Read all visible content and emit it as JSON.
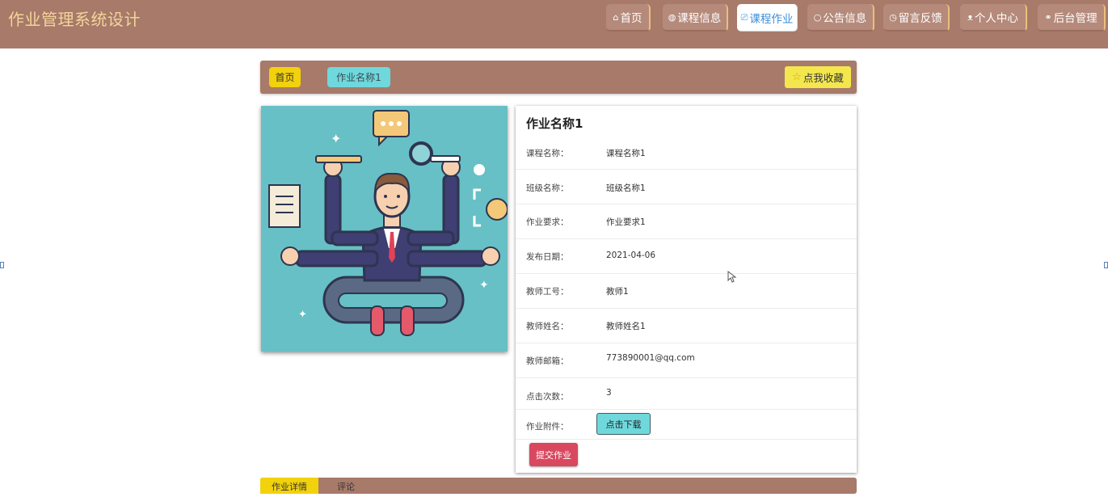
{
  "site": {
    "title": "作业管理系统设计"
  },
  "nav": [
    {
      "icon": "home-icon",
      "glyph": "⌂",
      "label": "首页"
    },
    {
      "icon": "globe-icon",
      "glyph": "◍",
      "label": "课程信息"
    },
    {
      "icon": "book-icon",
      "glyph": "⎚",
      "label": "课程作业"
    },
    {
      "icon": "chat-icon",
      "glyph": "○",
      "label": "公告信息"
    },
    {
      "icon": "clock-icon",
      "glyph": "◷",
      "label": "留言反馈"
    },
    {
      "icon": "user-icon",
      "glyph": "ᴥ",
      "label": "个人中心"
    },
    {
      "icon": "link-icon",
      "glyph": "⚭",
      "label": "后台管理"
    }
  ],
  "active_nav": "课程作业",
  "breadcrumb": {
    "home": "首页",
    "current": "作业名称1"
  },
  "favorite_label": "点我收藏",
  "detail": {
    "title": "作业名称1",
    "fields": [
      {
        "label": "课程名称：",
        "value": "课程名称1"
      },
      {
        "label": "班级名称：",
        "value": "班级名称1"
      },
      {
        "label": "作业要求：",
        "value": "作业要求1"
      },
      {
        "label": "发布日期：",
        "value": "2021-04-06"
      },
      {
        "label": "教师工号：",
        "value": "教师1"
      },
      {
        "label": "教师姓名：",
        "value": "教师姓名1"
      },
      {
        "label": "教师邮箱：",
        "value": "773890001@qq.com"
      },
      {
        "label": "点击次数：",
        "value": "3"
      }
    ],
    "attachment_label": "作业附件：",
    "download_label": "点击下载",
    "submit_label": "提交作业"
  },
  "bottom_tabs": [
    "作业详情",
    "评论"
  ],
  "colors": {
    "header": "#a87a6a",
    "title_text": "#f2d59a",
    "yellow": "#f1d20c",
    "cyan": "#6fd8dc",
    "red": "#d9485f",
    "image_bg": "#67c0c5"
  }
}
